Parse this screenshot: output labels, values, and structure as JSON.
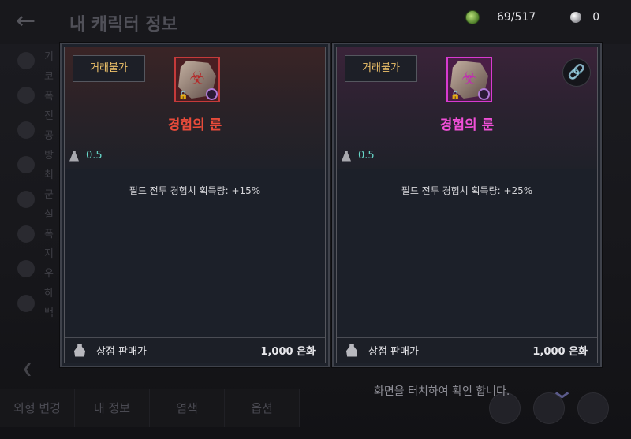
{
  "background": {
    "title": "내 캐릭터 정보",
    "left_text": [
      "기",
      "코",
      "폭",
      "진",
      "공",
      "방",
      "최",
      "군",
      "실",
      "폭",
      "지",
      "우",
      "하",
      "백"
    ],
    "bottom_tabs": [
      "외형 변경",
      "내 정보",
      "염색",
      "옵션"
    ],
    "touch_hint": "화면을 터치하여 확인 합니다."
  },
  "currency": {
    "green_coin": "69/517",
    "white_coin": "0"
  },
  "cards": [
    {
      "trade_badge": "거래불가",
      "item_name": "경험의 룬",
      "weight": "0.5",
      "effect": "필드 전투 경험치 획득량: +15%",
      "footer_label": "상점 판매가",
      "footer_price": "1,000 은화"
    },
    {
      "trade_badge": "거래불가",
      "item_name": "경험의 룬",
      "weight": "0.5",
      "effect": "필드 전투 경험치 획득량: +25%",
      "footer_label": "상점 판매가",
      "footer_price": "1,000 은화"
    }
  ],
  "colors": {
    "left_grade": "#e84b3a",
    "right_grade": "#f04fd7",
    "weight_text": "#67d7c8",
    "trade_badge_text": "#f0c36a"
  },
  "icons": {
    "back": "back-arrow-icon",
    "link": "link-icon",
    "weight": "weight-icon",
    "shop": "bag-icon"
  }
}
